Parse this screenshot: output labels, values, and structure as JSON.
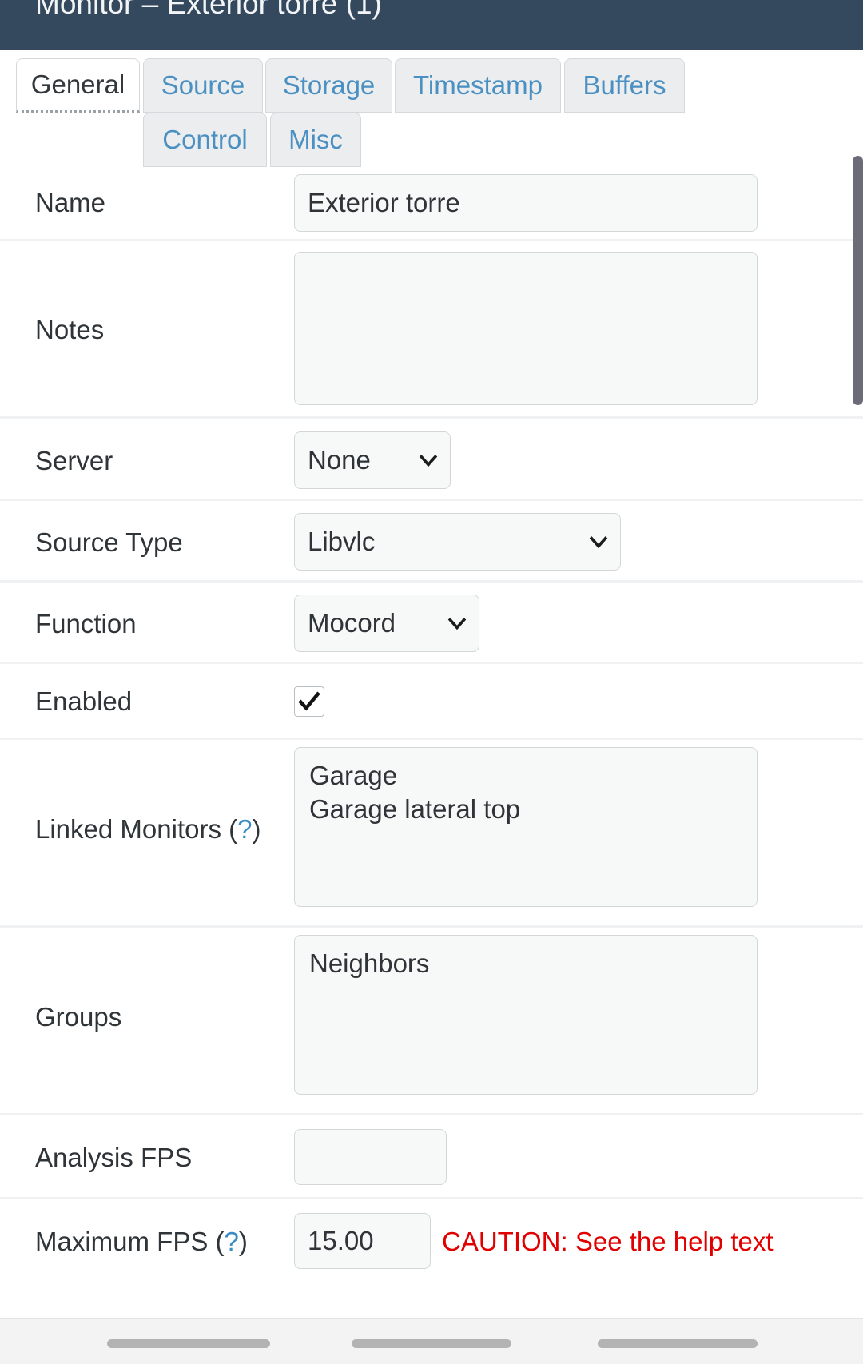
{
  "header": {
    "title": "Monitor – Exterior torre (1)",
    "background_color": "#34495e"
  },
  "tabs": [
    {
      "label": "General",
      "active": true
    },
    {
      "label": "Source",
      "active": false
    },
    {
      "label": "Storage",
      "active": false
    },
    {
      "label": "Timestamp",
      "active": false
    },
    {
      "label": "Buffers",
      "active": false
    },
    {
      "label": "Control",
      "active": false
    },
    {
      "label": "Misc",
      "active": false
    }
  ],
  "form": {
    "name": {
      "label": "Name",
      "value": "Exterior torre"
    },
    "notes": {
      "label": "Notes",
      "value": ""
    },
    "server": {
      "label": "Server",
      "value": "None",
      "icon": "chevron-down-icon"
    },
    "source_type": {
      "label": "Source Type",
      "value": "Libvlc",
      "icon": "chevron-down-icon"
    },
    "function": {
      "label": "Function",
      "value": "Mocord",
      "icon": "chevron-down-icon"
    },
    "enabled": {
      "label": "Enabled",
      "checked": true,
      "icon": "checkmark-icon"
    },
    "linked_monitors": {
      "label": "Linked Monitors (",
      "help": "?",
      "label_end": ")",
      "value": "Garage\nGarage lateral top"
    },
    "groups": {
      "label": "Groups",
      "value": "Neighbors"
    },
    "analysis_fps": {
      "label": "Analysis FPS",
      "value": ""
    },
    "maximum_fps": {
      "label": "Maximum FPS (",
      "help": "?",
      "label_end": ")",
      "value": "15.00",
      "caution": "CAUTION: See the help text",
      "caution_color": "#e00000"
    }
  },
  "scrollbar": {
    "thumb_color": "#6c6b78"
  },
  "navbar": {
    "pills": 3
  }
}
